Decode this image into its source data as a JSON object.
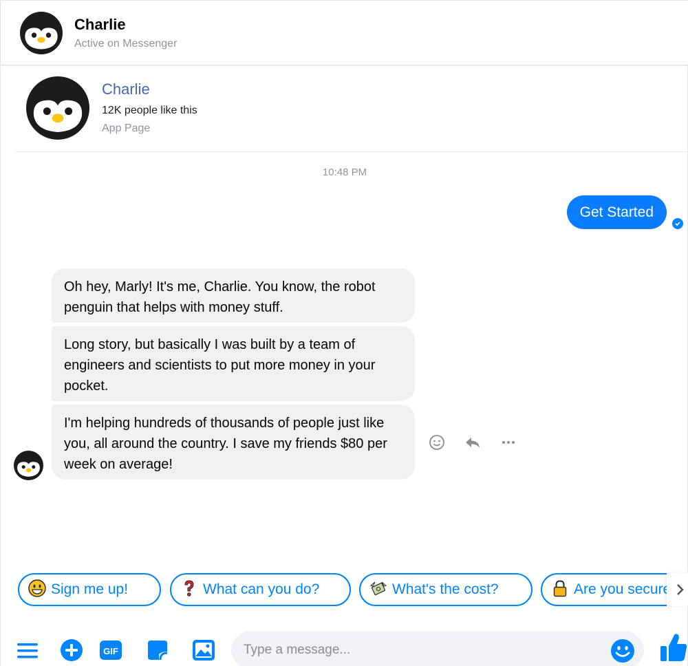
{
  "header": {
    "name": "Charlie",
    "status": "Active on Messenger",
    "avatar_icon": "penguin-avatar-icon"
  },
  "page_card": {
    "name": "Charlie",
    "likes": "12K people like this",
    "category": "App Page"
  },
  "conversation": {
    "timestamp": "10:48 PM",
    "outgoing": [
      {
        "text": "Get Started"
      }
    ],
    "incoming": [
      {
        "text": "Oh hey, Marly! It's me, Charlie. You know, the robot penguin that helps with money stuff."
      },
      {
        "text": "Long story, but basically I was built by a team of engineers and scientists to put more money in your pocket."
      },
      {
        "text": "I'm helping hundreds of thousands of people just like you, all around the country. I save my friends $80 per week on average!"
      }
    ],
    "message_actions": [
      "smiley-icon",
      "reply-icon",
      "more-icon"
    ]
  },
  "quick_replies": [
    {
      "emoji": "grinning-face-icon",
      "label": "Sign me up!"
    },
    {
      "emoji": "question-mark-icon",
      "label": "What can you do?"
    },
    {
      "emoji": "money-with-wings-icon",
      "label": "What's the cost?"
    },
    {
      "emoji": "lock-icon",
      "label": "Are you secure?"
    }
  ],
  "composer": {
    "placeholder": "Type a message...",
    "icons": [
      "menu-icon",
      "plus-icon",
      "gif-icon",
      "sticker-icon",
      "photo-icon",
      "emoji-icon",
      "thumbs-up-icon"
    ]
  },
  "colors": {
    "accent": "#0084ff",
    "outgoing_bubble": "#0a7cff",
    "incoming_bubble": "#f1f0f0",
    "page_name": "#4267b2",
    "muted_text": "#90949c"
  }
}
